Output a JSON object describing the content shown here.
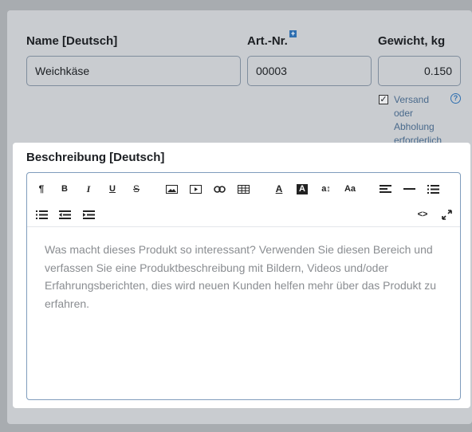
{
  "fields": {
    "name_label": "Name [Deutsch]",
    "name_value": "Weichkäse",
    "sku_label": "Art.-Nr.",
    "sku_value": "00003",
    "weight_label": "Gewicht, kg",
    "weight_value": "0.150",
    "shipping_checkbox_label": "Versand oder Abholung erforderlich"
  },
  "description": {
    "label": "Beschreibung [Deutsch]",
    "placeholder": "Was macht dieses Produkt so interessant? Verwenden Sie diesen Bereich und verfassen Sie eine Produktbeschreibung mit Bildern, Videos und/oder Erfahrungsberichten, dies wird neuen Kunden helfen mehr über das Produkt zu erfahren."
  },
  "toolbar": {
    "buttons": [
      {
        "name": "paragraph",
        "glyph": "¶"
      },
      {
        "name": "bold",
        "glyph": "B"
      },
      {
        "name": "italic",
        "glyph": "I"
      },
      {
        "name": "underline",
        "glyph": "U"
      },
      {
        "name": "strikethrough",
        "glyph": "S"
      },
      {
        "name": "image",
        "glyph": ""
      },
      {
        "name": "video",
        "glyph": ""
      },
      {
        "name": "link",
        "glyph": ""
      },
      {
        "name": "table",
        "glyph": ""
      },
      {
        "name": "font-color",
        "glyph": "A"
      },
      {
        "name": "background-color",
        "glyph": "A"
      },
      {
        "name": "font-size",
        "glyph": "a↕"
      },
      {
        "name": "font-family",
        "glyph": "Aa"
      },
      {
        "name": "align",
        "glyph": ""
      },
      {
        "name": "horizontal-rule",
        "glyph": ""
      },
      {
        "name": "unordered-list",
        "glyph": ""
      },
      {
        "name": "ordered-list",
        "glyph": ""
      },
      {
        "name": "outdent",
        "glyph": ""
      },
      {
        "name": "indent",
        "glyph": ""
      },
      {
        "name": "code-view",
        "glyph": "<>"
      },
      {
        "name": "fullscreen",
        "glyph": ""
      }
    ]
  },
  "checkbox_checked": true,
  "colors": {
    "accent": "#2f6fb0",
    "overlay": "#c9ccd0"
  }
}
